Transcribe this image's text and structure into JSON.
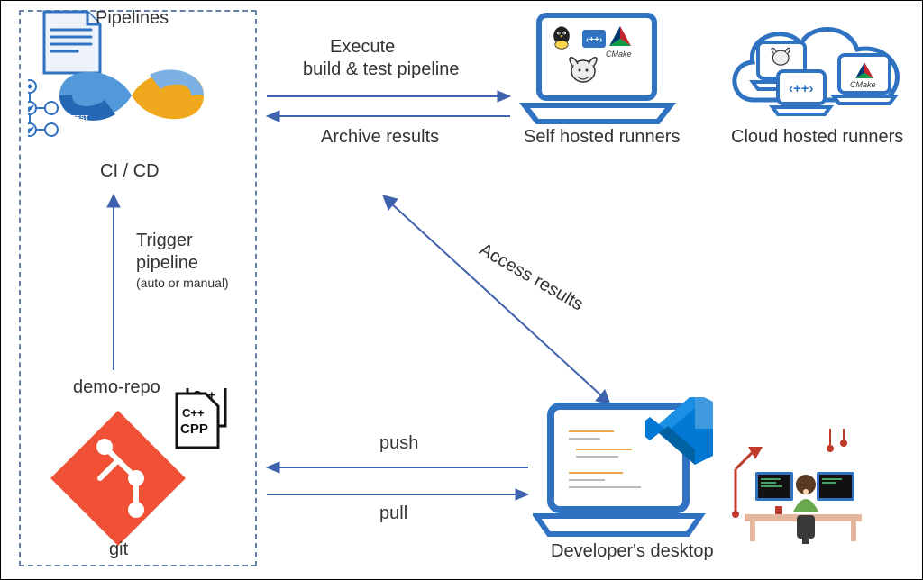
{
  "pipelines_label": "Pipelines",
  "cicd_label": "CI / CD",
  "trigger_label_line1": "Trigger",
  "trigger_label_line2": "pipeline",
  "trigger_label_line3": "(auto or manual)",
  "demo_repo_label": "demo-repo",
  "git_label": "git",
  "cpp_label_big": "CPP",
  "cpp_label_small": "C++",
  "execute_label_line1": "Execute",
  "execute_label_line2": "build & test pipeline",
  "archive_label": "Archive results",
  "self_hosted_label": "Self hosted runners",
  "cloud_hosted_label": "Cloud hosted runners",
  "cmake_label": "CMake",
  "access_results_label": "Access results",
  "push_label": "push",
  "pull_label": "pull",
  "developer_label": "Developer's desktop",
  "inf_test_label": "TEST"
}
